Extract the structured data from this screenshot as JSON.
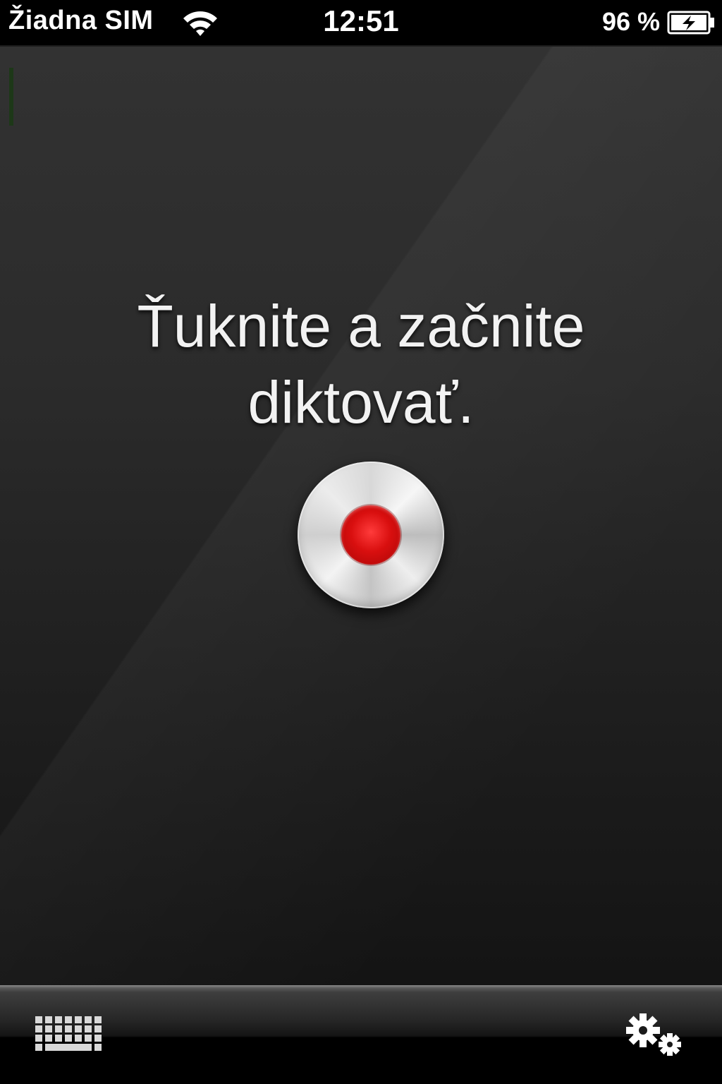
{
  "status_bar": {
    "carrier": "Žiadna SIM",
    "time": "12:51",
    "battery_percent": "96 %",
    "wifi_icon": "wifi-icon",
    "battery_icon": "battery-charging-icon"
  },
  "main": {
    "prompt_line_1": "Ťuknite a začnite",
    "prompt_line_2": "diktovať.",
    "record_button_icon": "record-icon"
  },
  "toolbar": {
    "keyboard_icon": "keyboard-icon",
    "settings_icon": "gears-icon"
  },
  "colors": {
    "record_red": "#d90f0f",
    "background_top": "#333333",
    "background_bottom": "#101010"
  }
}
